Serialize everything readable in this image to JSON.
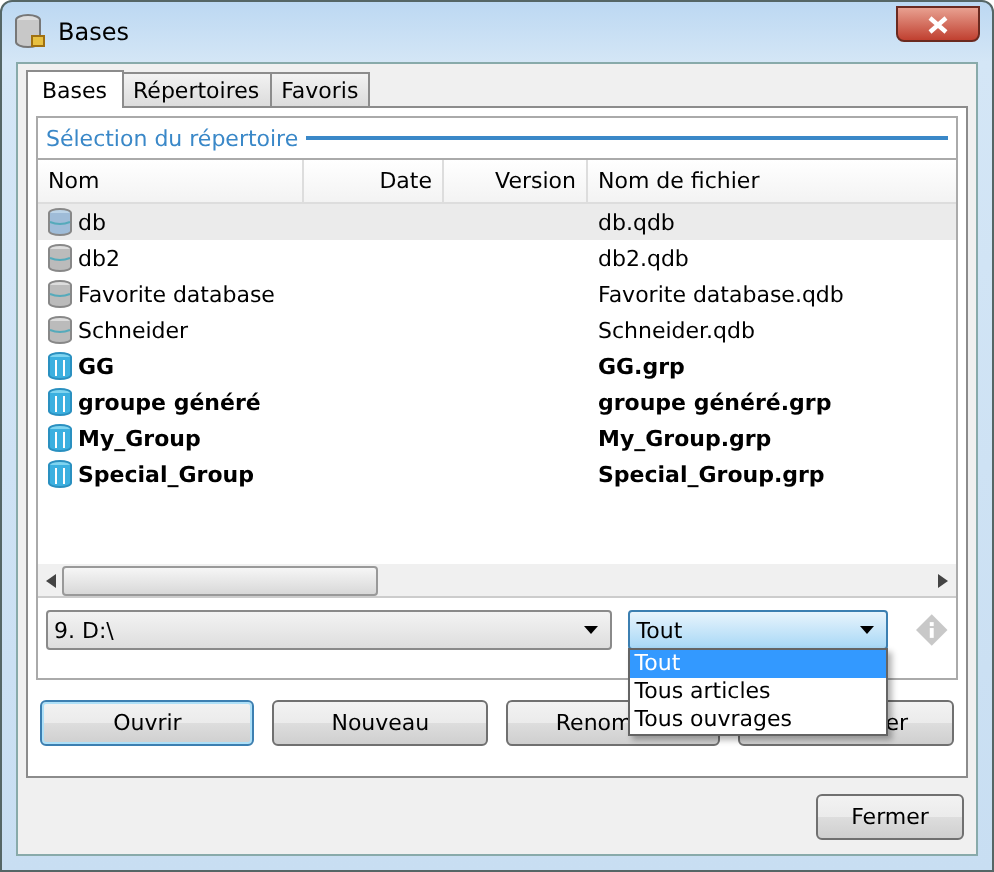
{
  "window": {
    "title": "Bases"
  },
  "tabs": [
    {
      "label": "Bases",
      "selected": true
    },
    {
      "label": "Répertoires",
      "selected": false
    },
    {
      "label": "Favoris",
      "selected": false
    }
  ],
  "group": {
    "title": "Sélection du répertoire"
  },
  "table": {
    "columns": [
      "Nom",
      "Date",
      "Version",
      "Nom de fichier"
    ],
    "rows": [
      {
        "kind": "database",
        "name": "db",
        "file": "db.qdb",
        "selected": true
      },
      {
        "kind": "database",
        "name": "db2",
        "file": "db2.qdb",
        "selected": false
      },
      {
        "kind": "database",
        "name": "Favorite database",
        "file": "Favorite database.qdb",
        "selected": false
      },
      {
        "kind": "database",
        "name": "Schneider",
        "file": "Schneider.qdb",
        "selected": false
      },
      {
        "kind": "group",
        "name": "GG",
        "file": "GG.grp",
        "selected": false
      },
      {
        "kind": "group",
        "name": "groupe généré",
        "file": "groupe généré.grp",
        "selected": false
      },
      {
        "kind": "group",
        "name": "My_Group",
        "file": "My_Group.grp",
        "selected": false
      },
      {
        "kind": "group",
        "name": "Special_Group",
        "file": "Special_Group.grp",
        "selected": false
      }
    ]
  },
  "directory_combo": {
    "value": "9. D:\\"
  },
  "filter_combo": {
    "value": "Tout",
    "expanded": true,
    "options": [
      {
        "label": "Tout",
        "selected": true
      },
      {
        "label": "Tous articles",
        "selected": false
      },
      {
        "label": "Tous ouvrages",
        "selected": false
      }
    ]
  },
  "buttons": [
    {
      "label": "Ouvrir",
      "default": true,
      "kind": "whole"
    },
    {
      "label": "Nouveau",
      "default": false,
      "kind": "whole"
    },
    {
      "label": "Renom",
      "default": false,
      "kind": "headshown"
    },
    {
      "label": "er",
      "default": false,
      "kind": "tailshown"
    }
  ],
  "close_button": {
    "label": "Fermer"
  }
}
